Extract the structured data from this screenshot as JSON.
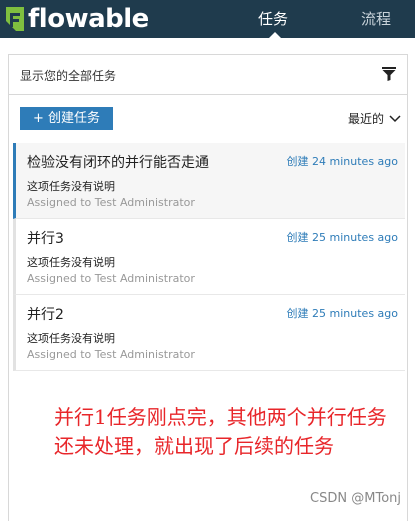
{
  "app": {
    "logo_text": "flowable",
    "brand_color": "#7fbf3f",
    "nav": [
      {
        "label": "任务",
        "active": true
      },
      {
        "label": "流程",
        "active": false
      }
    ]
  },
  "filter": {
    "label": "显示您的全部任务",
    "icon": "filter-icon"
  },
  "toolbar": {
    "create_label": "+ 创建任务",
    "sort_label": "最近的",
    "accent_color": "#2e7cb8"
  },
  "tasks": [
    {
      "title": "检验没有闭环的并行能否走通",
      "created": "创建 24 minutes ago",
      "description": "这项任务没有说明",
      "assignee": "Assigned to Test Administrator",
      "selected": true
    },
    {
      "title": "并行3",
      "created": "创建 25 minutes ago",
      "description": "这项任务没有说明",
      "assignee": "Assigned to Test Administrator",
      "selected": false
    },
    {
      "title": "并行2",
      "created": "创建 25 minutes ago",
      "description": "这项任务没有说明",
      "assignee": "Assigned to Test Administrator",
      "selected": false
    }
  ],
  "annotation": {
    "text": "并行1任务刚点完，其他两个并行任务还未处理，就出现了后续的任务",
    "color": "#e8262a"
  },
  "watermark": "CSDN @MTonj"
}
